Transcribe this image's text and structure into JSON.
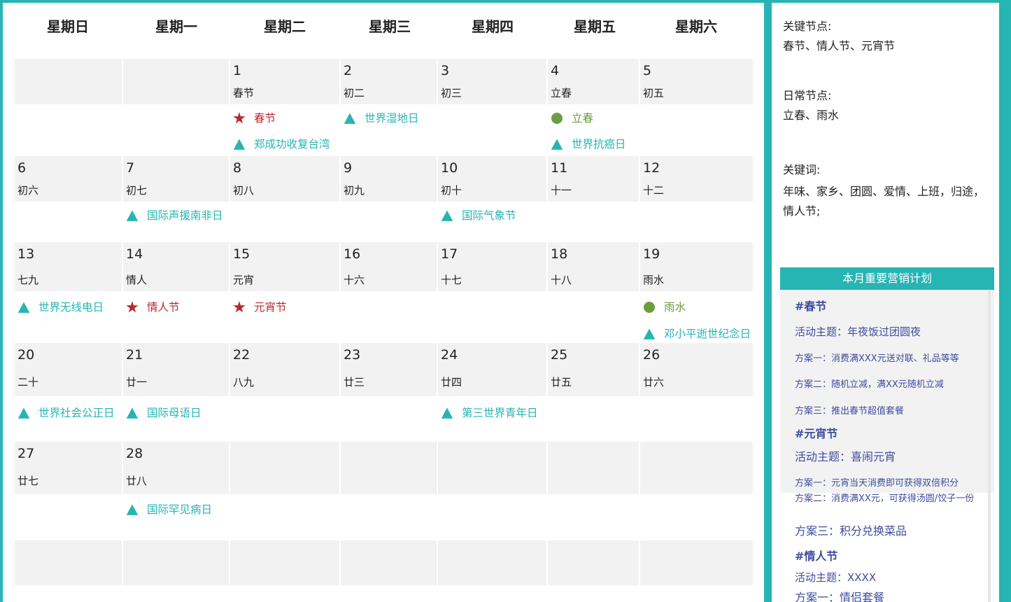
{
  "weekdays": [
    "星期日",
    "星期一",
    "星期二",
    "星期三",
    "星期四",
    "星期五",
    "星期六"
  ],
  "weeks": [
    [
      {
        "day": "",
        "lunar": "",
        "events": []
      },
      {
        "day": "",
        "lunar": "",
        "events": []
      },
      {
        "day": "1",
        "lunar": "春节",
        "events": [
          {
            "type": "key",
            "text": "春节"
          },
          {
            "type": "intl",
            "text": "郑成功收复台湾"
          }
        ]
      },
      {
        "day": "2",
        "lunar": "初二",
        "events": [
          {
            "type": "intl",
            "text": "世界湿地日"
          }
        ]
      },
      {
        "day": "3",
        "lunar": "初三",
        "events": []
      },
      {
        "day": "4",
        "lunar": "立春",
        "events": [
          {
            "type": "day",
            "text": "立春"
          },
          {
            "type": "intl",
            "text": "世界抗癌日"
          }
        ]
      },
      {
        "day": "5",
        "lunar": "初五",
        "events": []
      }
    ],
    [
      {
        "day": "6",
        "lunar": "初六",
        "events": []
      },
      {
        "day": "7",
        "lunar": "初七",
        "events": [
          {
            "type": "intl",
            "text": "国际声援南非日"
          }
        ]
      },
      {
        "day": "8",
        "lunar": "初八",
        "events": []
      },
      {
        "day": "9",
        "lunar": "初九",
        "events": []
      },
      {
        "day": "10",
        "lunar": "初十",
        "events": [
          {
            "type": "intl",
            "text": "国际气象节"
          }
        ]
      },
      {
        "day": "11",
        "lunar": "十一",
        "events": []
      },
      {
        "day": "12",
        "lunar": "十二",
        "events": []
      }
    ],
    [
      {
        "day": "13",
        "lunar": "七九",
        "events": [
          {
            "type": "intl",
            "text": "世界无线电日"
          }
        ]
      },
      {
        "day": "14",
        "lunar": "情人",
        "events": [
          {
            "type": "key",
            "text": "情人节"
          }
        ]
      },
      {
        "day": "15",
        "lunar": "元宵",
        "events": [
          {
            "type": "key",
            "text": "元宵节"
          }
        ]
      },
      {
        "day": "16",
        "lunar": "十六",
        "events": []
      },
      {
        "day": "17",
        "lunar": "十七",
        "events": []
      },
      {
        "day": "18",
        "lunar": "十八",
        "events": []
      },
      {
        "day": "19",
        "lunar": "雨水",
        "events": [
          {
            "type": "day",
            "text": "雨水"
          },
          {
            "type": "intl",
            "text": "邓小平逝世纪念日"
          }
        ]
      }
    ],
    [
      {
        "day": "20",
        "lunar": "二十",
        "events": [
          {
            "type": "intl",
            "text": "世界社会公正日"
          }
        ]
      },
      {
        "day": "21",
        "lunar": "廿一",
        "events": [
          {
            "type": "intl",
            "text": "国际母语日"
          }
        ]
      },
      {
        "day": "22",
        "lunar": "八九",
        "events": []
      },
      {
        "day": "23",
        "lunar": "廿三",
        "events": []
      },
      {
        "day": "24",
        "lunar": "廿四",
        "events": [
          {
            "type": "intl",
            "text": "第三世界青年日"
          }
        ]
      },
      {
        "day": "25",
        "lunar": "廿五",
        "events": []
      },
      {
        "day": "26",
        "lunar": "廿六",
        "events": []
      }
    ],
    [
      {
        "day": "27",
        "lunar": "廿七",
        "events": []
      },
      {
        "day": "28",
        "lunar": "廿八",
        "events": [
          {
            "type": "intl",
            "text": "国际罕见病日"
          }
        ]
      },
      {
        "day": "",
        "lunar": "",
        "events": []
      },
      {
        "day": "",
        "lunar": "",
        "events": []
      },
      {
        "day": "",
        "lunar": "",
        "events": []
      },
      {
        "day": "",
        "lunar": "",
        "events": []
      },
      {
        "day": "",
        "lunar": "",
        "events": []
      }
    ],
    [
      {
        "day": "",
        "lunar": "",
        "events": []
      },
      {
        "day": "",
        "lunar": "",
        "events": []
      },
      {
        "day": "",
        "lunar": "",
        "events": []
      },
      {
        "day": "",
        "lunar": "",
        "events": []
      },
      {
        "day": "",
        "lunar": "",
        "events": []
      },
      {
        "day": "",
        "lunar": "",
        "events": []
      },
      {
        "day": "",
        "lunar": "",
        "events": []
      }
    ]
  ],
  "sidebar": {
    "key_nodes_label": "关键节点:",
    "key_nodes_value": "春节、情人节、元宵节",
    "daily_nodes_label": "日常节点:",
    "daily_nodes_value": "立春、雨水",
    "keywords_label": "关键词:",
    "keywords_value": "年味、家乡、团圆、爱情、上班，归途，情人节;",
    "plan_title": "本月重要营销计划",
    "plans": [
      {
        "heading": "#春节",
        "theme": "活动主题：年夜饭过团圆夜",
        "items": [
          "方案一：消费满XXX元送对联、礼品等等",
          "方案二：随机立减，满XX元随机立减",
          "方案三：推出春节超值套餐"
        ]
      },
      {
        "heading": "#元宵节",
        "theme": "活动主题：喜闹元宵",
        "items": [
          "方案一：元宵当天消费即可获得双倍积分",
          "方案二：消费满XX元，可获得汤圆/饺子一份",
          "方案三：积分兑换菜品"
        ]
      },
      {
        "heading": "#情人节",
        "theme": "活动主题：XXXX",
        "items": [
          "方案一：情侣套餐"
        ]
      }
    ]
  },
  "colors": {
    "accent": "#26b5b3",
    "key_event": "#b8282e",
    "daily_event": "#6a9e3f",
    "plan_text": "#3e4c9e"
  },
  "icons": {
    "key": "star-icon",
    "day": "circle-icon",
    "intl": "triangle-icon"
  }
}
